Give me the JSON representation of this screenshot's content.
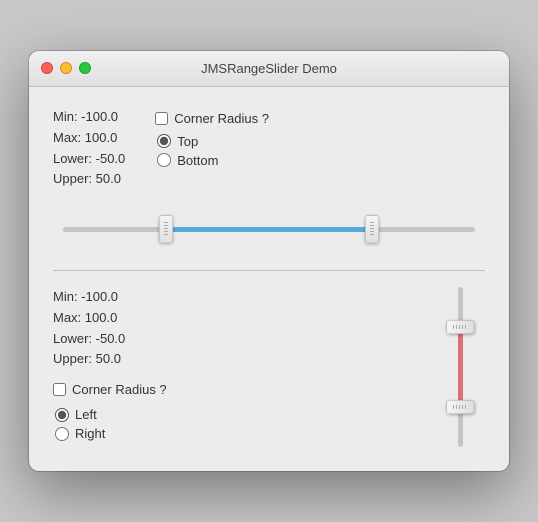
{
  "window": {
    "title": "JMSRangeSlider Demo"
  },
  "top_section": {
    "min_label": "Min: -100.0",
    "max_label": "Max: 100.0",
    "lower_label": "Lower: -50.0",
    "upper_label": "Upper: 50.0",
    "corner_radius_label": "Corner Radius ?",
    "radio_top_label": "Top",
    "radio_bottom_label": "Bottom"
  },
  "bottom_section": {
    "min_label": "Min: -100.0",
    "max_label": "Max: 100.0",
    "lower_label": "Lower: -50.0",
    "upper_label": "Upper: 50.0",
    "corner_radius_label": "Corner Radius ?",
    "radio_left_label": "Left",
    "radio_right_label": "Right"
  },
  "slider_top": {
    "fill_color": "#5aa8e0",
    "left_pct": 25,
    "right_pct": 75
  },
  "slider_bottom": {
    "fill_color": "#e07070",
    "top_pct": 25,
    "bottom_pct": 75
  }
}
